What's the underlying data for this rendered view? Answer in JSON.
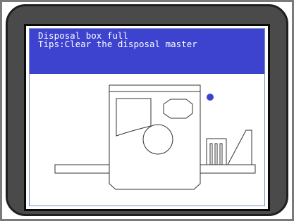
{
  "error_panel": {
    "title": "Disposal box full",
    "tip": "Tips:Clear the disposal master"
  },
  "colors": {
    "message_background": "#3d43cf",
    "message_text": "#ffffff",
    "indicator_dot": "#3d43cf",
    "bezel": "#4a4a4a",
    "line_art": "#333333"
  },
  "icons": {
    "machine": "printer-machine-icon",
    "indicator": "status-indicator-icon",
    "disposal_box": "disposal-box-icon"
  }
}
